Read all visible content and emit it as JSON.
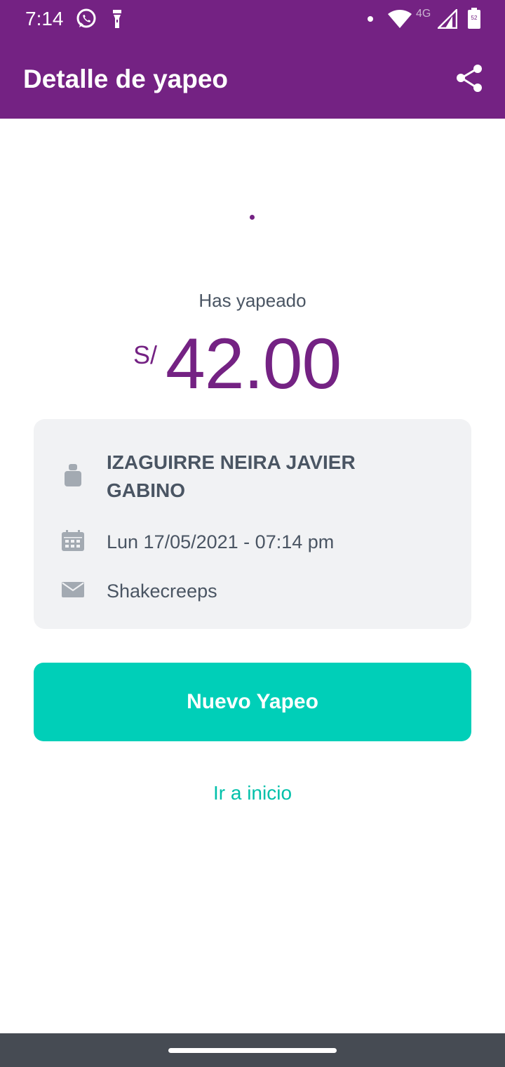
{
  "status_bar": {
    "time": "7:14",
    "network_label": "4G",
    "battery_level": "52",
    "icons": [
      "whatsapp-icon",
      "flashlight-icon",
      "notification-dot-icon",
      "wifi-icon",
      "cellular-signal-icon",
      "battery-icon"
    ]
  },
  "app_bar": {
    "title": "Detalle de yapeo",
    "share_icon": "share-icon"
  },
  "summary": {
    "label": "Has yapeado",
    "currency": "S/",
    "amount": "42.00"
  },
  "details": {
    "recipient_name": "IZAGUIRRE NEIRA JAVIER GABINO",
    "datetime": "Lun 17/05/2021 - 07:14 pm",
    "message": "Shakecreeps",
    "icons": [
      "person-icon",
      "calendar-icon",
      "envelope-icon"
    ]
  },
  "actions": {
    "new_payment_label": "Nuevo Yapeo",
    "go_home_label": "Ir a inicio"
  },
  "colors": {
    "brand_purple": "#742283",
    "accent_teal": "#00cfb8",
    "card_background": "#f1f2f4",
    "text_gray": "#4a5563",
    "nav_bar": "#464b53"
  }
}
